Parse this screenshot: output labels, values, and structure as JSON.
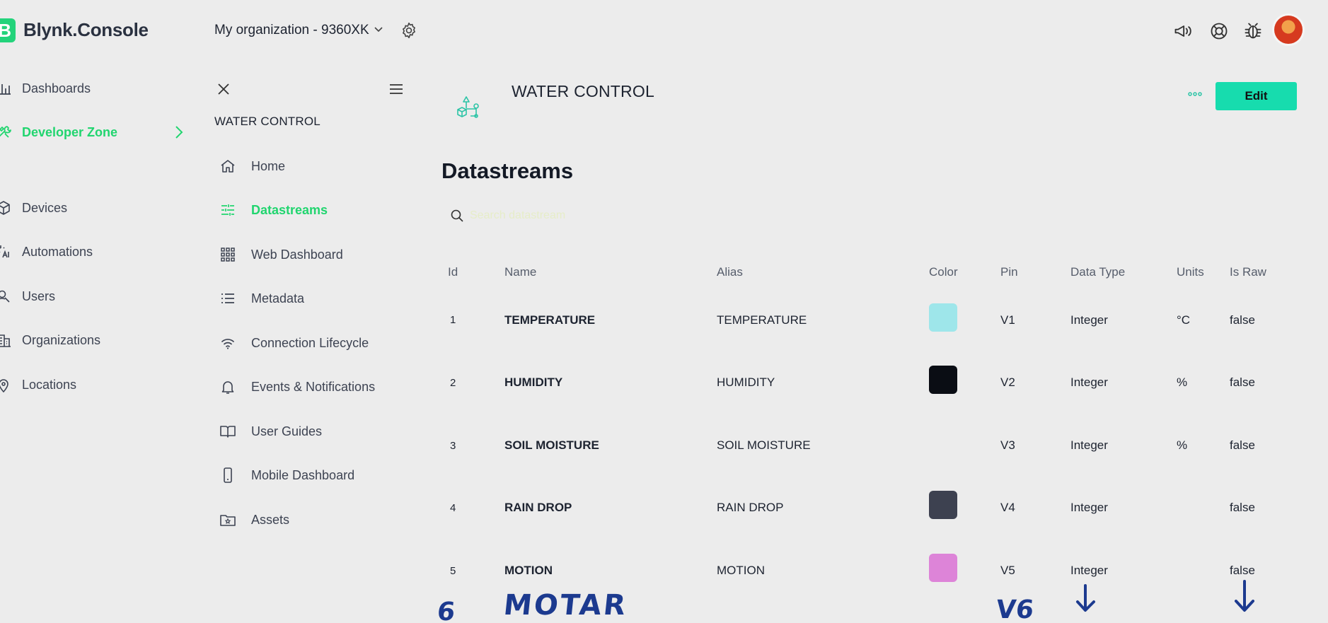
{
  "app": {
    "logo_letter": "B",
    "name": "Blynk.Console"
  },
  "header": {
    "org_name": "My organization - 9360XK"
  },
  "sidebar": {
    "items": [
      {
        "label": "Dashboards"
      },
      {
        "label": "Developer Zone"
      },
      {
        "label": "Devices"
      },
      {
        "label": "Automations"
      },
      {
        "label": "Users"
      },
      {
        "label": "Organizations"
      },
      {
        "label": "Locations"
      }
    ]
  },
  "subnav": {
    "title": "WATER CONTROL",
    "items": [
      {
        "label": "Home"
      },
      {
        "label": "Datastreams"
      },
      {
        "label": "Web Dashboard"
      },
      {
        "label": "Metadata"
      },
      {
        "label": "Connection Lifecycle"
      },
      {
        "label": "Events & Notifications"
      },
      {
        "label": "User Guides"
      },
      {
        "label": "Mobile Dashboard"
      },
      {
        "label": "Assets"
      }
    ]
  },
  "content": {
    "template_name": "WATER CONTROL",
    "edit_label": "Edit",
    "page_title": "Datastreams",
    "search_placeholder": "Search datastream"
  },
  "table": {
    "headers": {
      "id": "Id",
      "name": "Name",
      "alias": "Alias",
      "color": "Color",
      "pin": "Pin",
      "data_type": "Data Type",
      "units": "Units",
      "is_raw": "Is Raw"
    },
    "rows": [
      {
        "id": "1",
        "name": "TEMPERATURE",
        "alias": "TEMPERATURE",
        "color": "#9ee6ea",
        "pin": "V1",
        "data_type": "Integer",
        "units": "°C",
        "is_raw": "false"
      },
      {
        "id": "2",
        "name": "HUMIDITY",
        "alias": "HUMIDITY",
        "color": "#0a0d14",
        "pin": "V2",
        "data_type": "Integer",
        "units": "%",
        "is_raw": "false"
      },
      {
        "id": "3",
        "name": "SOIL MOISTURE",
        "alias": "SOIL MOISTURE",
        "color": "",
        "pin": "V3",
        "data_type": "Integer",
        "units": "%",
        "is_raw": "false"
      },
      {
        "id": "4",
        "name": "RAIN DROP",
        "alias": "RAIN DROP",
        "color": "#3d4150",
        "pin": "V4",
        "data_type": "Integer",
        "units": "",
        "is_raw": "false"
      },
      {
        "id": "5",
        "name": "MOTION",
        "alias": "MOTION",
        "color": "#dd84d8",
        "pin": "V5",
        "data_type": "Integer",
        "units": "",
        "is_raw": "false"
      }
    ]
  },
  "annotation": {
    "id": "6",
    "name": "MOTAR",
    "pin": "V6"
  },
  "colors": {
    "accent_green": "#21d56f",
    "edit_button": "#17dcae"
  }
}
